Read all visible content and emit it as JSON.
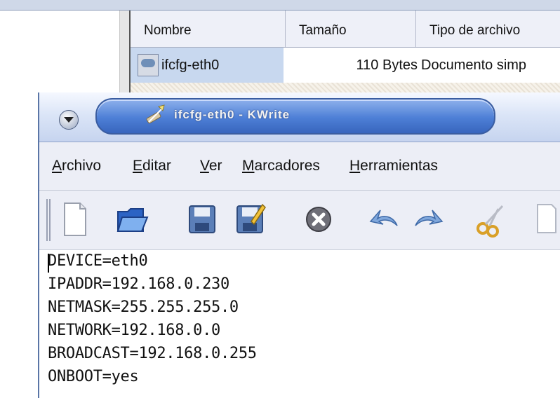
{
  "file_manager": {
    "columns": [
      "Nombre",
      "Tamaño",
      "Tipo de archivo"
    ],
    "row": {
      "name": "ifcfg-eth0",
      "size": "110 Bytes",
      "type": "Documento simp",
      "icon": "text-file-icon"
    }
  },
  "editor": {
    "title": "ifcfg-eth0 - KWrite",
    "menu": [
      "Archivo",
      "Editar",
      "Ver",
      "Marcadores",
      "Herramientas"
    ],
    "toolbar": [
      "new-document-icon",
      "open-folder-icon",
      "save-icon",
      "save-as-icon",
      "close-icon",
      "undo-icon",
      "redo-icon",
      "cut-icon",
      "copy-icon"
    ],
    "lines": [
      "DEVICE=eth0",
      "IPADDR=192.168.0.230",
      "NETMASK=255.255.255.0",
      "NETWORK=192.168.0.0",
      "BROADCAST=192.168.0.255",
      "ONBOOT=yes"
    ]
  },
  "colors": {
    "title_pill": "#4d7fd6",
    "menubar_bg": "#eceef6",
    "selection": "#c8d8ef"
  }
}
